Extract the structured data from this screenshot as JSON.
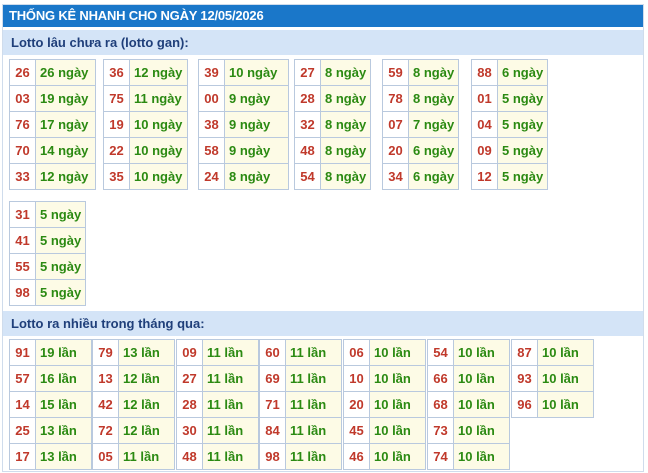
{
  "title": "THỐNG KÊ NHANH CHO NGÀY 12/05/2026",
  "section1": {
    "heading": "Lotto lâu chưa ra (lotto gan):",
    "groups": [
      [
        [
          "26",
          "26 ngày"
        ],
        [
          "03",
          "19 ngày"
        ],
        [
          "76",
          "17 ngày"
        ],
        [
          "70",
          "14 ngày"
        ],
        [
          "33",
          "12 ngày"
        ]
      ],
      [
        [
          "36",
          "12 ngày"
        ],
        [
          "75",
          "11 ngày"
        ],
        [
          "19",
          "10 ngày"
        ],
        [
          "22",
          "10 ngày"
        ],
        [
          "35",
          "10 ngày"
        ]
      ],
      [
        [
          "39",
          "10 ngày"
        ],
        [
          "00",
          "9 ngày"
        ],
        [
          "38",
          "9 ngày"
        ],
        [
          "58",
          "9 ngày"
        ],
        [
          "24",
          "8 ngày"
        ]
      ],
      [
        [
          "27",
          "8 ngày"
        ],
        [
          "28",
          "8 ngày"
        ],
        [
          "32",
          "8 ngày"
        ],
        [
          "48",
          "8 ngày"
        ],
        [
          "54",
          "8 ngày"
        ]
      ],
      [
        [
          "59",
          "8 ngày"
        ],
        [
          "78",
          "8 ngày"
        ],
        [
          "07",
          "7 ngày"
        ],
        [
          "20",
          "6 ngày"
        ],
        [
          "34",
          "6 ngày"
        ]
      ],
      [
        [
          "88",
          "6 ngày"
        ],
        [
          "01",
          "5 ngày"
        ],
        [
          "04",
          "5 ngày"
        ],
        [
          "09",
          "5 ngày"
        ],
        [
          "12",
          "5 ngày"
        ]
      ],
      [
        [
          "31",
          "5 ngày"
        ],
        [
          "41",
          "5 ngày"
        ],
        [
          "55",
          "5 ngày"
        ],
        [
          "98",
          "5 ngày"
        ]
      ]
    ]
  },
  "section2": {
    "heading": "Lotto ra nhiều trong tháng qua:",
    "groups": [
      [
        [
          "91",
          "19 lần"
        ],
        [
          "57",
          "16 lần"
        ],
        [
          "14",
          "15 lần"
        ],
        [
          "25",
          "13 lần"
        ],
        [
          "17",
          "13 lần"
        ]
      ],
      [
        [
          "79",
          "13 lần"
        ],
        [
          "13",
          "12 lần"
        ],
        [
          "42",
          "12 lần"
        ],
        [
          "72",
          "12 lần"
        ],
        [
          "05",
          "11 lần"
        ]
      ],
      [
        [
          "09",
          "11 lần"
        ],
        [
          "27",
          "11 lần"
        ],
        [
          "28",
          "11 lần"
        ],
        [
          "30",
          "11 lần"
        ],
        [
          "48",
          "11 lần"
        ]
      ],
      [
        [
          "60",
          "11 lần"
        ],
        [
          "69",
          "11 lần"
        ],
        [
          "71",
          "11 lần"
        ],
        [
          "84",
          "11 lần"
        ],
        [
          "98",
          "11 lần"
        ]
      ],
      [
        [
          "06",
          "10 lần"
        ],
        [
          "10",
          "10 lần"
        ],
        [
          "20",
          "10 lần"
        ],
        [
          "45",
          "10 lần"
        ],
        [
          "46",
          "10 lần"
        ]
      ],
      [
        [
          "54",
          "10 lần"
        ],
        [
          "66",
          "10 lần"
        ],
        [
          "68",
          "10 lần"
        ],
        [
          "73",
          "10 lần"
        ],
        [
          "74",
          "10 lần"
        ]
      ],
      [
        [
          "87",
          "10 lần"
        ],
        [
          "93",
          "10 lần"
        ],
        [
          "96",
          "10 lần"
        ]
      ]
    ]
  }
}
